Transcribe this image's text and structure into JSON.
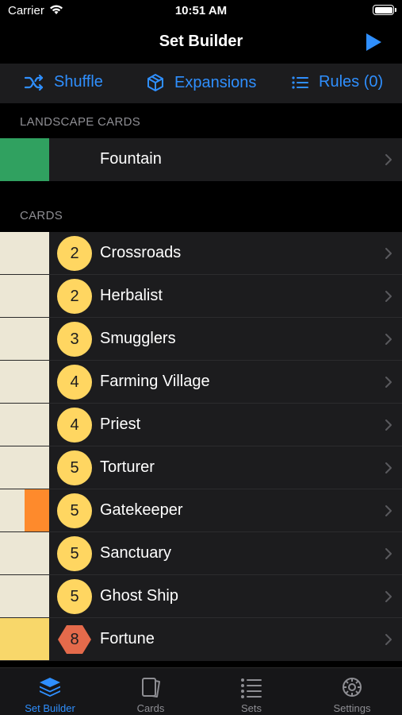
{
  "status_bar": {
    "carrier": "Carrier",
    "time": "10:51 AM"
  },
  "nav": {
    "title": "Set Builder"
  },
  "toolbar": {
    "shuffle": "Shuffle",
    "expansions": "Expansions",
    "rules": "Rules (0)"
  },
  "colors": {
    "accent": "#2f8ffe",
    "coin": "#ffd661",
    "potion_hex": "#e46a4b",
    "action_card": "#ece7d5",
    "treasure_card": "#f8d76a",
    "reaction_or_duration": "#fe8a2c",
    "landscape_green": "#30a160"
  },
  "landscape_section": {
    "header": "LANDSCAPE CARDS",
    "items": [
      {
        "name": "Fountain",
        "swatch": "#30a160"
      }
    ]
  },
  "cards_section": {
    "header": "CARDS",
    "items": [
      {
        "cost": "2",
        "name": "Crossroads",
        "swatch": "#ece7d5"
      },
      {
        "cost": "2",
        "name": "Herbalist",
        "swatch": "#ece7d5"
      },
      {
        "cost": "3",
        "name": "Smugglers",
        "swatch": "#ece7d5"
      },
      {
        "cost": "4",
        "name": "Farming Village",
        "swatch": "#ece7d5"
      },
      {
        "cost": "4",
        "name": "Priest",
        "swatch": "#ece7d5"
      },
      {
        "cost": "5",
        "name": "Torturer",
        "swatch": "#ece7d5"
      },
      {
        "cost": "5",
        "name": "Gatekeeper",
        "swatch": "#ece7d5",
        "swatch2": "#fe8a2c"
      },
      {
        "cost": "5",
        "name": "Sanctuary",
        "swatch": "#ece7d5"
      },
      {
        "cost": "5",
        "name": "Ghost Ship",
        "swatch": "#ece7d5"
      },
      {
        "cost": "8",
        "name": "Fortune",
        "swatch": "#f8d76a",
        "cost_shape": "hex"
      }
    ]
  },
  "tab_bar": {
    "items": [
      {
        "label": "Set Builder",
        "icon": "stack-icon",
        "active": true
      },
      {
        "label": "Cards",
        "icon": "cards-icon",
        "active": false
      },
      {
        "label": "Sets",
        "icon": "list-icon",
        "active": false
      },
      {
        "label": "Settings",
        "icon": "gear-icon",
        "active": false
      }
    ]
  }
}
